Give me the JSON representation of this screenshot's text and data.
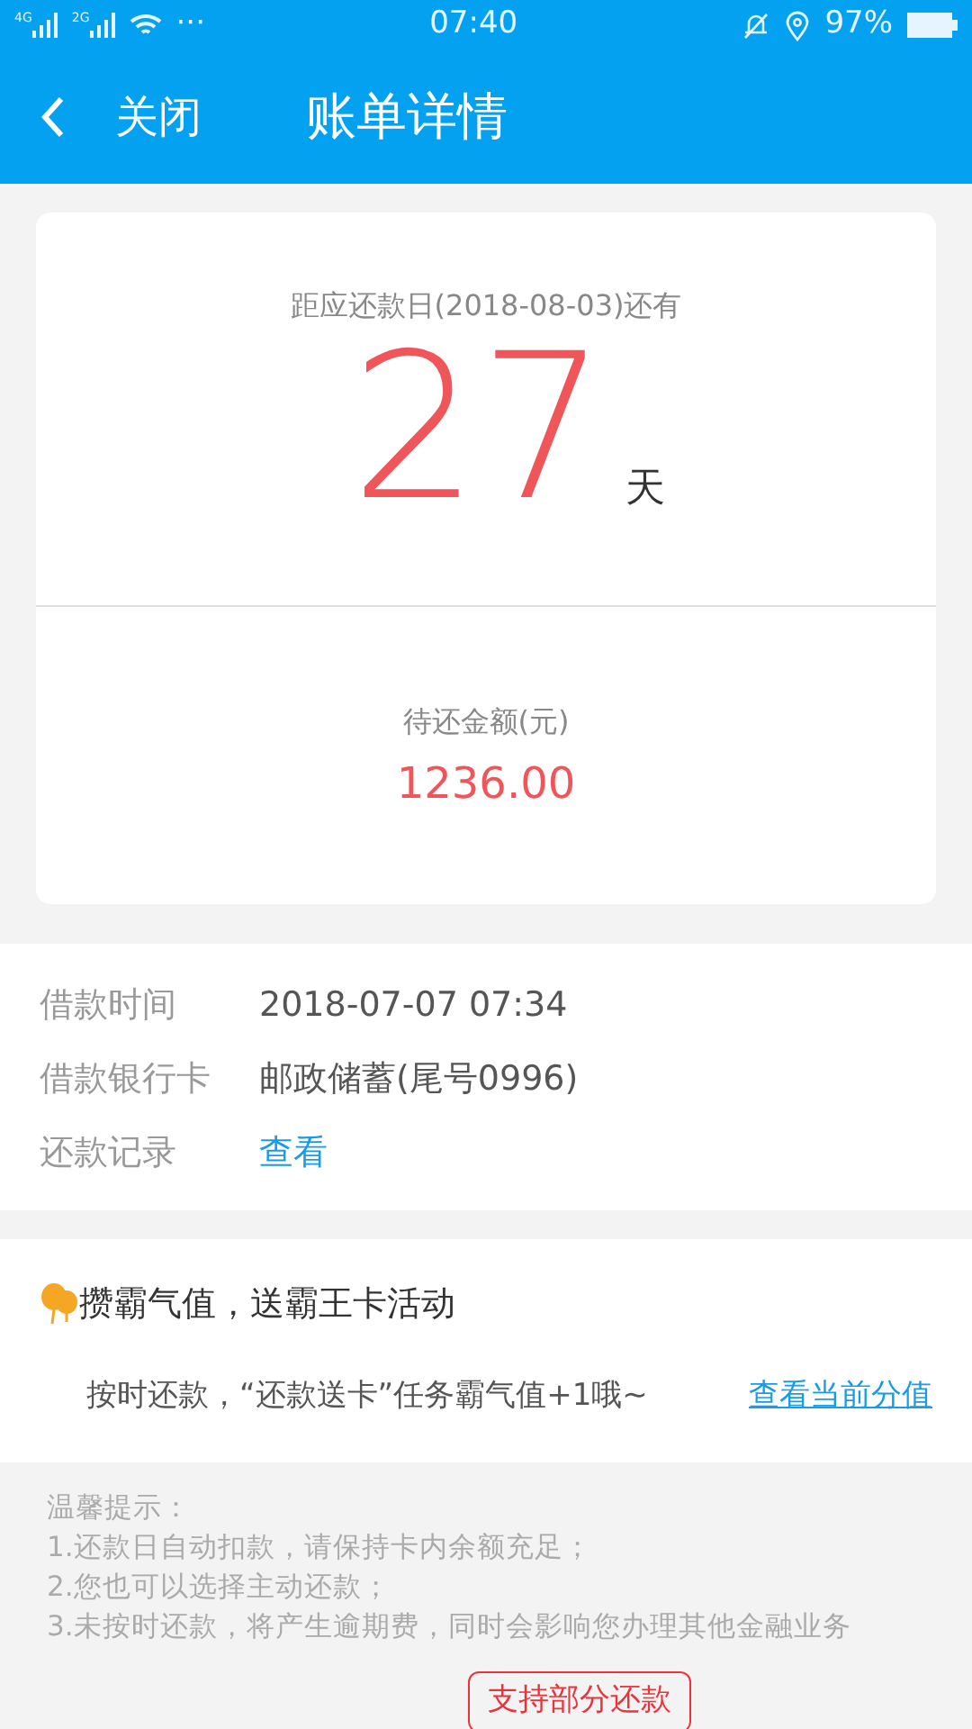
{
  "status_bar": {
    "signals": [
      "4G",
      "2G"
    ],
    "more": "···",
    "time": "07:40",
    "battery": "97%"
  },
  "nav": {
    "back": "关闭",
    "title": "账单详情"
  },
  "countdown": {
    "label": "距应还款日(2018-08-03)还有",
    "days": "27",
    "unit": "天"
  },
  "amount": {
    "label": "待还金额(元)",
    "value": "1236.00"
  },
  "details": [
    {
      "kind": "text",
      "label": "借款时间",
      "value": "2018-07-07 07:34"
    },
    {
      "kind": "text",
      "label": "借款银行卡",
      "value": "邮政储蓄(尾号0996)"
    },
    {
      "kind": "link",
      "label": "还款记录",
      "value": "查看"
    }
  ],
  "promo": {
    "title": "攒霸气值，送霸王卡活动",
    "text": "按时还款，“还款送卡”任务霸气值+1哦~",
    "link": "查看当前分值"
  },
  "tips": [
    "温馨提示：",
    "1.还款日自动扣款，请保持卡内余额充足；",
    "2.您也可以选择主动还款；",
    "3.未按时还款，将产生逾期费，同时会影响您办理其他金融业务"
  ],
  "button": "支持部分还款"
}
